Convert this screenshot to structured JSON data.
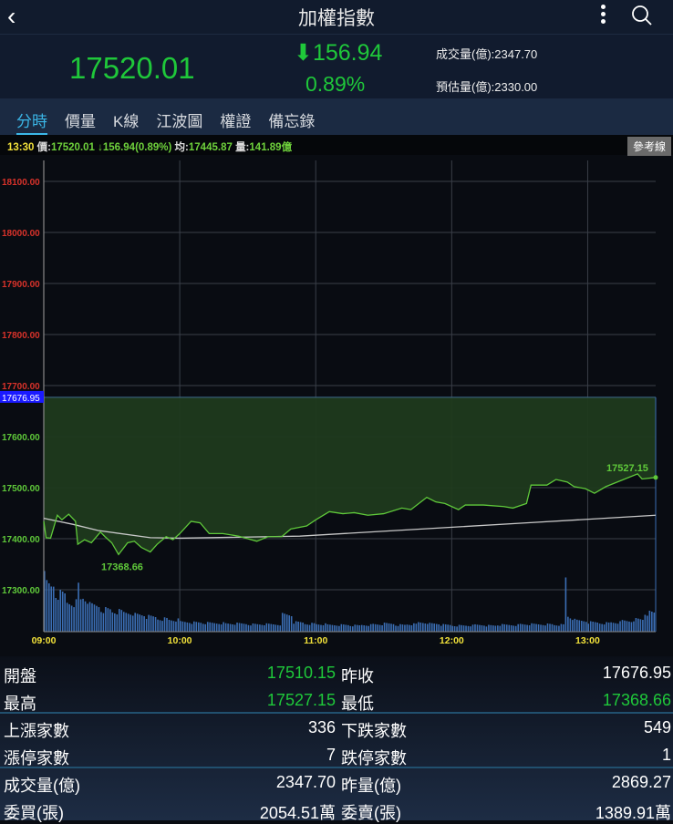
{
  "header": {
    "title": "加權指數",
    "back_icon": "chevron-left-icon",
    "more_icon": "more-vertical-icon",
    "search_icon": "search-icon"
  },
  "quote": {
    "price": "17520.01",
    "change": "156.94",
    "change_direction": "down",
    "percent": "0.89%",
    "volume": "成交量(億):2347.70",
    "est_volume": "預估量(億):2330.00"
  },
  "tabs": [
    {
      "label": "分時",
      "active": true
    },
    {
      "label": "價量"
    },
    {
      "label": "K線"
    },
    {
      "label": "江波圖"
    },
    {
      "label": "權證"
    },
    {
      "label": "備忘錄"
    }
  ],
  "info_bar": {
    "time": "13:30",
    "price_label": "價:",
    "price": "17520.01",
    "change": "↓156.94(0.89%)",
    "avg_label": "均:",
    "avg": "17445.87",
    "vol_label": "量:",
    "vol": "141.89億",
    "ref_button": "參考線"
  },
  "colors": {
    "up": "#e0352b",
    "down": "#1fc83a",
    "accent": "#3bb7e8",
    "ref": "#1a1aff"
  },
  "chart_data": {
    "type": "line",
    "ref_price": 17676.95,
    "ref_label": "17676.95",
    "ylim": [
      17220,
      18130
    ],
    "y_ticks": [
      "18100.00",
      "18000.00",
      "17900.00",
      "17800.00",
      "17700.00",
      "17600.00",
      "17500.00",
      "17400.00",
      "17300.00"
    ],
    "x_ticks": [
      "09:00",
      "10:00",
      "11:00",
      "12:00",
      "13:00"
    ],
    "x_range_minutes": [
      0,
      270
    ],
    "high_label": "17527.15",
    "low_label": "17368.66",
    "price": [
      [
        0,
        17434
      ],
      [
        1,
        17402
      ],
      [
        3,
        17401
      ],
      [
        6,
        17446
      ],
      [
        8,
        17437
      ],
      [
        11,
        17448
      ],
      [
        14,
        17434
      ],
      [
        15,
        17389
      ],
      [
        18,
        17398
      ],
      [
        21,
        17392
      ],
      [
        25,
        17413
      ],
      [
        27,
        17404
      ],
      [
        30,
        17392
      ],
      [
        33,
        17369
      ],
      [
        37,
        17392
      ],
      [
        40,
        17395
      ],
      [
        43,
        17383
      ],
      [
        47,
        17374
      ],
      [
        50,
        17389
      ],
      [
        54,
        17404
      ],
      [
        57,
        17398
      ],
      [
        60,
        17410
      ],
      [
        65,
        17434
      ],
      [
        69,
        17431
      ],
      [
        73,
        17410
      ],
      [
        79,
        17410
      ],
      [
        86,
        17405
      ],
      [
        94,
        17395
      ],
      [
        99,
        17404
      ],
      [
        105,
        17404
      ],
      [
        109,
        17419
      ],
      [
        116,
        17425
      ],
      [
        120,
        17437
      ],
      [
        126,
        17453
      ],
      [
        132,
        17449
      ],
      [
        137,
        17451
      ],
      [
        143,
        17446
      ],
      [
        150,
        17449
      ],
      [
        158,
        17460
      ],
      [
        162,
        17457
      ],
      [
        169,
        17481
      ],
      [
        173,
        17472
      ],
      [
        177,
        17469
      ],
      [
        183,
        17457
      ],
      [
        186,
        17466
      ],
      [
        194,
        17466
      ],
      [
        203,
        17463
      ],
      [
        207,
        17460
      ],
      [
        213,
        17469
      ],
      [
        215,
        17505
      ],
      [
        222,
        17505
      ],
      [
        226,
        17516
      ],
      [
        231,
        17511
      ],
      [
        234,
        17502
      ],
      [
        239,
        17498
      ],
      [
        243,
        17489
      ],
      [
        248,
        17502
      ],
      [
        253,
        17511
      ],
      [
        262,
        17527
      ],
      [
        264,
        17517
      ],
      [
        270,
        17520
      ]
    ],
    "average": [
      [
        0,
        17440
      ],
      [
        13,
        17428
      ],
      [
        24,
        17416
      ],
      [
        47,
        17402
      ],
      [
        60,
        17401
      ],
      [
        113,
        17405
      ],
      [
        213,
        17431
      ],
      [
        270,
        17446
      ]
    ],
    "volume_5min": [
      235,
      120,
      95,
      150,
      85,
      72,
      65,
      62,
      55,
      48,
      42,
      38,
      32,
      30,
      28,
      28,
      26,
      26,
      24,
      24,
      24,
      55,
      30,
      26,
      24,
      22,
      22,
      20,
      22,
      24,
      26,
      22,
      24,
      30,
      26,
      22,
      20,
      20,
      22,
      20,
      22,
      22,
      24,
      24,
      24,
      22,
      170,
      35,
      30,
      28,
      30,
      35,
      40,
      60,
      85
    ]
  },
  "stats": [
    {
      "l1": "開盤",
      "v1": "17510.15",
      "c1": "down",
      "l2": "昨收",
      "v2": "17676.95",
      "c2": "flat"
    },
    {
      "l1": "最高",
      "v1": "17527.15",
      "c1": "down",
      "l2": "最低",
      "v2": "17368.66",
      "c2": "down"
    },
    {
      "l1": "上漲家數",
      "v1": "336",
      "c1": "flat",
      "l2": "下跌家數",
      "v2": "549",
      "c2": "flat"
    },
    {
      "l1": "漲停家數",
      "v1": "7",
      "c1": "flat",
      "l2": "跌停家數",
      "v2": "1",
      "c2": "flat"
    },
    {
      "l1": "成交量(億)",
      "v1": "2347.70",
      "c1": "flat",
      "l2": "昨量(億)",
      "v2": "2869.27",
      "c2": "flat"
    },
    {
      "l1": "委買(張)",
      "v1": "2054.51萬",
      "c1": "flat",
      "l2": "委賣(張)",
      "v2": "1389.91萬",
      "c2": "flat"
    }
  ]
}
